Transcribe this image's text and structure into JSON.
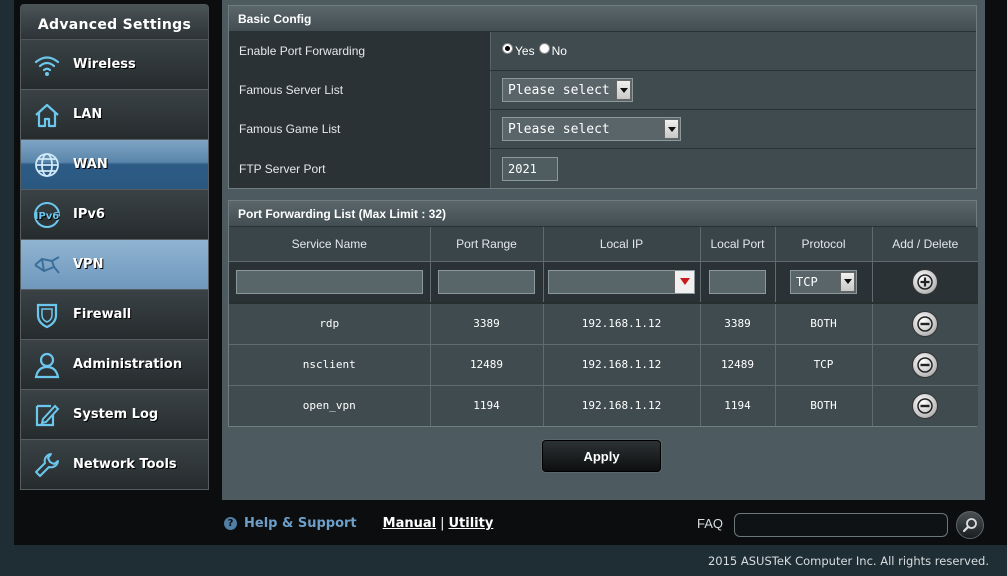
{
  "sidebar": {
    "title": "Advanced Settings",
    "items": [
      {
        "label": "Wireless",
        "icon": "wifi-icon"
      },
      {
        "label": "LAN",
        "icon": "home-icon"
      },
      {
        "label": "WAN",
        "icon": "globe-icon"
      },
      {
        "label": "IPv6",
        "icon": "ipv6-icon"
      },
      {
        "label": "VPN",
        "icon": "vpn-icon"
      },
      {
        "label": "Firewall",
        "icon": "shield-icon"
      },
      {
        "label": "Administration",
        "icon": "user-icon"
      },
      {
        "label": "System Log",
        "icon": "log-icon"
      },
      {
        "label": "Network Tools",
        "icon": "wrench-icon"
      }
    ]
  },
  "basic_config": {
    "title": "Basic Config",
    "enable_label": "Enable Port Forwarding",
    "yes_label": "Yes",
    "no_label": "No",
    "selected": "Yes",
    "server_list_label": "Famous Server List",
    "server_list_value": "Please select",
    "game_list_label": "Famous Game List",
    "game_list_value": "Please select",
    "ftp_label": "FTP Server Port",
    "ftp_value": "2021"
  },
  "pf_list": {
    "title": "Port Forwarding List (Max Limit : 32)",
    "headers": [
      "Service Name",
      "Port Range",
      "Local IP",
      "Local Port",
      "Protocol",
      "Add / Delete"
    ],
    "input_protocol": "TCP",
    "rows": [
      {
        "service": "rdp",
        "port_range": "3389",
        "local_ip": "192.168.1.12",
        "local_port": "3389",
        "protocol": "BOTH"
      },
      {
        "service": "nsclient",
        "port_range": "12489",
        "local_ip": "192.168.1.12",
        "local_port": "12489",
        "protocol": "TCP"
      },
      {
        "service": "open_vpn",
        "port_range": "1194",
        "local_ip": "192.168.1.12",
        "local_port": "1194",
        "protocol": "BOTH"
      }
    ]
  },
  "apply_label": "Apply",
  "footer": {
    "help": "Help & Support",
    "manual": "Manual",
    "utility": "Utility",
    "separator": "|",
    "faq": "FAQ",
    "copyright": "2015 ASUSTeK Computer Inc. All rights reserved."
  }
}
